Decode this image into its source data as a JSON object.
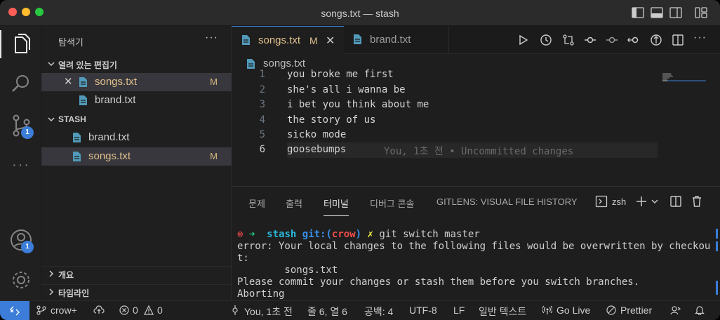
{
  "window": {
    "title": "songs.txt — stash"
  },
  "explorer": {
    "title": "탐색기",
    "more": "···",
    "open_editors": {
      "label": "열려 있는 편집기",
      "items": [
        {
          "name": "songs.txt",
          "status": "M"
        },
        {
          "name": "brand.txt",
          "status": ""
        }
      ]
    },
    "folder": {
      "label": "STASH",
      "items": [
        {
          "name": "brand.txt",
          "status": ""
        },
        {
          "name": "songs.txt",
          "status": "M"
        }
      ]
    },
    "outline": "개요",
    "timeline": "타임라인"
  },
  "activity_bar": {
    "scm_badge": "1",
    "account_badge": "1"
  },
  "tabs": [
    {
      "label": "songs.txt",
      "status": "M",
      "active": true
    },
    {
      "label": "brand.txt",
      "status": "",
      "active": false
    }
  ],
  "breadcrumb": {
    "file": "songs.txt"
  },
  "editor": {
    "lines": [
      {
        "num": "1",
        "text": "you broke me first"
      },
      {
        "num": "2",
        "text": "she's all i wanna be"
      },
      {
        "num": "3",
        "text": "i bet you think about me"
      },
      {
        "num": "4",
        "text": "the story of us"
      },
      {
        "num": "5",
        "text": "sicko mode"
      },
      {
        "num": "6",
        "text": "goosebumps"
      }
    ],
    "blame": "You, 1초 전 • Uncommitted changes"
  },
  "panel": {
    "tabs": [
      "문제",
      "출력",
      "터미널",
      "디버그 콘솔",
      "GITLENS: VISUAL FILE HISTORY"
    ],
    "active_tab": "터미널",
    "shell": "zsh",
    "terminal": {
      "prompt_error_mark": "⊗",
      "prompt_arrow": "➜",
      "prompt_dir": "stash",
      "prompt_git": "git:(",
      "prompt_branch": "crow",
      "prompt_git_end": ")",
      "prompt_dirty": "✗",
      "command": "git switch master",
      "output_1": "error: Your local changes to the following files would be overwritten by checkou",
      "output_2": "t:",
      "output_3": "        songs.txt",
      "output_4": "Please commit your changes or stash them before you switch branches.",
      "output_5": "Aborting"
    }
  },
  "status_bar": {
    "branch": "crow+",
    "errors": "0",
    "warnings": "0",
    "blame": "You, 1초 전",
    "position": "줄 6, 열 6",
    "indent": "공백: 4",
    "encoding": "UTF-8",
    "eol": "LF",
    "language": "일반 텍스트",
    "golive": "Go Live",
    "prettier": "Prettier"
  },
  "colors": {
    "accent": "#3b7dd8",
    "modified": "#e2c08d",
    "file_icon": "#519aba"
  }
}
